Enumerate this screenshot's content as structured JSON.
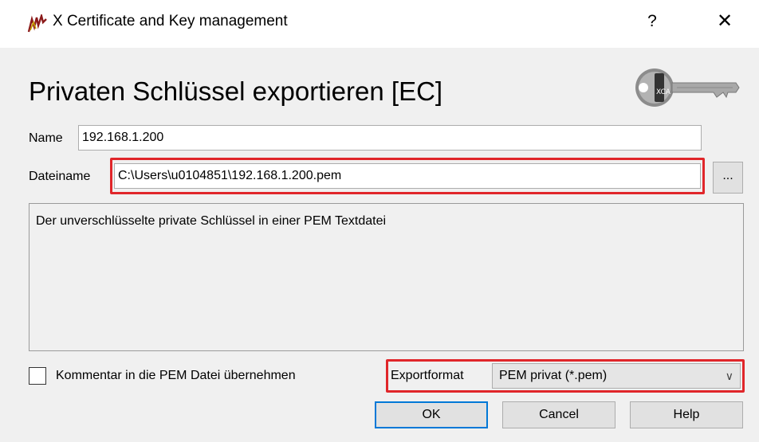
{
  "window": {
    "title": "X Certificate and Key management",
    "help_label": "?",
    "close_label": "✕"
  },
  "dialog": {
    "heading": "Privaten Schlüssel exportieren [EC]",
    "name_label": "Name",
    "name_value": "192.168.1.200",
    "filename_label": "Dateiname",
    "filename_value": "C:\\Users\\u0104851\\192.168.1.200.pem",
    "browse_label": "...",
    "description": "Der unverschlüsselte private Schlüssel in einer PEM Textdatei",
    "comment_checkbox_label": "Kommentar in die PEM Datei übernehmen",
    "comment_checked": false,
    "exportformat_label": "Exportformat",
    "exportformat_value": "PEM privat (*.pem)"
  },
  "buttons": {
    "ok": "OK",
    "cancel": "Cancel",
    "help": "Help"
  },
  "colors": {
    "highlight": "#e0262a",
    "focus": "#0078d7",
    "panel": "#f0f0f0"
  },
  "icons": [
    "xca-app-icon",
    "key-icon",
    "chevron-down-icon",
    "close-icon"
  ]
}
